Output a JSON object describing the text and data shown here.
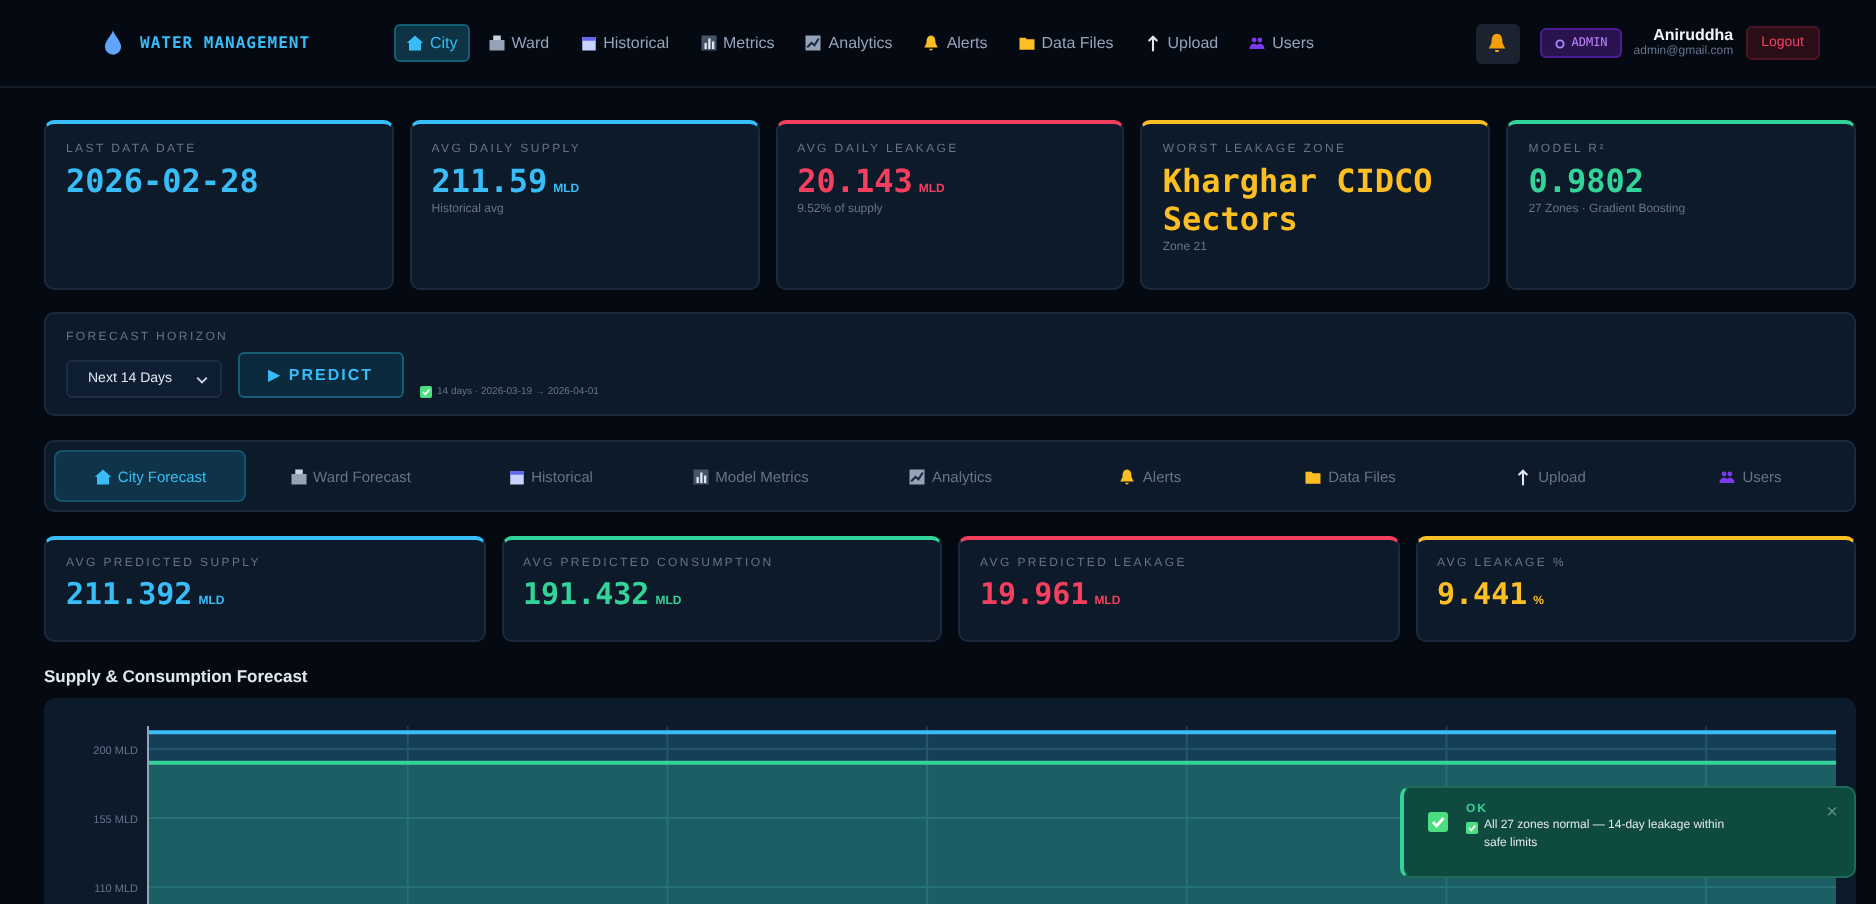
{
  "header": {
    "logo": "WATER MANAGEMENT",
    "nav": [
      {
        "label": "City",
        "selected": true
      },
      {
        "label": "Ward",
        "selected": false
      },
      {
        "label": "Historical",
        "selected": false
      },
      {
        "label": "Metrics",
        "selected": false
      },
      {
        "label": "Analytics",
        "selected": false
      },
      {
        "label": "Alerts",
        "selected": false
      },
      {
        "label": "Data Files",
        "selected": false
      },
      {
        "label": "Upload",
        "selected": false
      },
      {
        "label": "Users",
        "selected": false
      }
    ],
    "role_badge": "ADMIN",
    "user": {
      "name": "Aniruddha",
      "email": "admin@gmail.com"
    },
    "logout": "Logout"
  },
  "summary_cards": [
    {
      "label": "LAST DATA DATE",
      "value": "2026-02-28",
      "color": "#38bdf8"
    },
    {
      "label": "AVG DAILY SUPPLY",
      "value": "211.59",
      "unit": "MLD",
      "note": "Historical avg",
      "color": "#38bdf8"
    },
    {
      "label": "AVG DAILY LEAKAGE",
      "value": "20.143",
      "unit": "MLD",
      "note": "9.52% of supply",
      "color": "#f43f5e"
    },
    {
      "label": "WORST LEAKAGE ZONE",
      "value": "Kharghar CIDCO Sectors",
      "note": "Zone 21",
      "color": "#fbbf24"
    },
    {
      "label": "MODEL R²",
      "value": "0.9802",
      "note": "27 Zones · Gradient Boosting",
      "color": "#34d399"
    }
  ],
  "forecast": {
    "label": "FORECAST HORIZON",
    "horizon": "Next 14 Days",
    "predict_button": "▶ PREDICT",
    "status": "14 days · 2026-03-19 → 2026-04-01"
  },
  "tabs": [
    {
      "label": "City Forecast",
      "selected": true
    },
    {
      "label": "Ward Forecast",
      "selected": false
    },
    {
      "label": "Historical",
      "selected": false
    },
    {
      "label": "Model Metrics",
      "selected": false
    },
    {
      "label": "Analytics",
      "selected": false
    },
    {
      "label": "Alerts",
      "selected": false
    },
    {
      "label": "Data Files",
      "selected": false
    },
    {
      "label": "Upload",
      "selected": false
    },
    {
      "label": "Users",
      "selected": false
    }
  ],
  "prediction_cards": [
    {
      "label": "AVG PREDICTED SUPPLY",
      "value": "211.392",
      "unit": "MLD",
      "color": "#38bdf8"
    },
    {
      "label": "AVG PREDICTED CONSUMPTION",
      "value": "191.432",
      "unit": "MLD",
      "color": "#34d399"
    },
    {
      "label": "AVG PREDICTED LEAKAGE",
      "value": "19.961",
      "unit": "MLD",
      "color": "#f43f5e"
    },
    {
      "label": "AVG LEAKAGE %",
      "value": "9.441",
      "unit": "%",
      "color": "#fbbf24"
    }
  ],
  "forecast_chart": {
    "title": "Supply & Consumption Forecast",
    "chart_data": {
      "type": "area",
      "grid": true,
      "ylim": [
        95,
        215
      ],
      "yticks": [
        {
          "value": 200,
          "label": "200 MLD"
        },
        {
          "value": 155,
          "label": "155 MLD"
        },
        {
          "value": 110,
          "label": "110 MLD"
        }
      ],
      "series": [
        {
          "color": "#38bdf8",
          "values": [
            211,
            211,
            211,
            211,
            211,
            211,
            211,
            211,
            211,
            211,
            211,
            211,
            211,
            211
          ]
        },
        {
          "color": "#34d399",
          "values": [
            191,
            191,
            191,
            191,
            191,
            191,
            191,
            191,
            191,
            191,
            191,
            191,
            191,
            191
          ]
        }
      ]
    }
  },
  "toast": {
    "title": "OK",
    "message": "All 27 zones normal — 14-day leakage within safe limits",
    "close": "×"
  }
}
